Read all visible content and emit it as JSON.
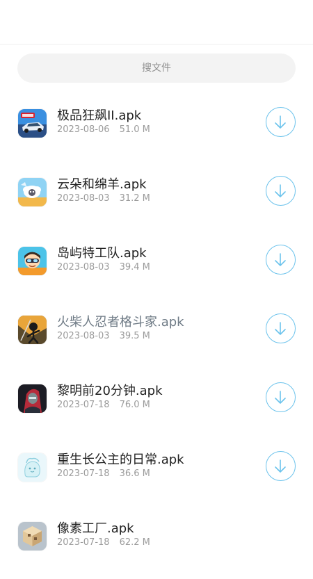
{
  "search": {
    "placeholder": "搜文件"
  },
  "accent_color": "#6cc3ec",
  "files": [
    {
      "name": "极品狂飙II.apk",
      "date": "2023-08-06",
      "size": "51.0 M",
      "icon": "racing-car-icon"
    },
    {
      "name": "云朵和绵羊.apk",
      "date": "2023-08-03",
      "size": "31.2 M",
      "icon": "sheep-cloud-icon"
    },
    {
      "name": "岛屿特工队.apk",
      "date": "2023-08-03",
      "size": "39.4 M",
      "icon": "island-agent-icon"
    },
    {
      "name": "火柴人忍者格斗家.apk",
      "date": "2023-08-03",
      "size": "39.5 M",
      "icon": "stickman-ninja-icon"
    },
    {
      "name": "黎明前20分钟.apk",
      "date": "2023-07-18",
      "size": "76.0 M",
      "icon": "dark-hero-icon"
    },
    {
      "name": "重生长公主的日常.apk",
      "date": "2023-07-18",
      "size": "36.6 M",
      "icon": "princess-icon"
    },
    {
      "name": "像素工厂.apk",
      "date": "2023-07-18",
      "size": "62.2 M",
      "icon": "pixel-factory-icon"
    }
  ],
  "download_icon": "download-arrow-icon"
}
